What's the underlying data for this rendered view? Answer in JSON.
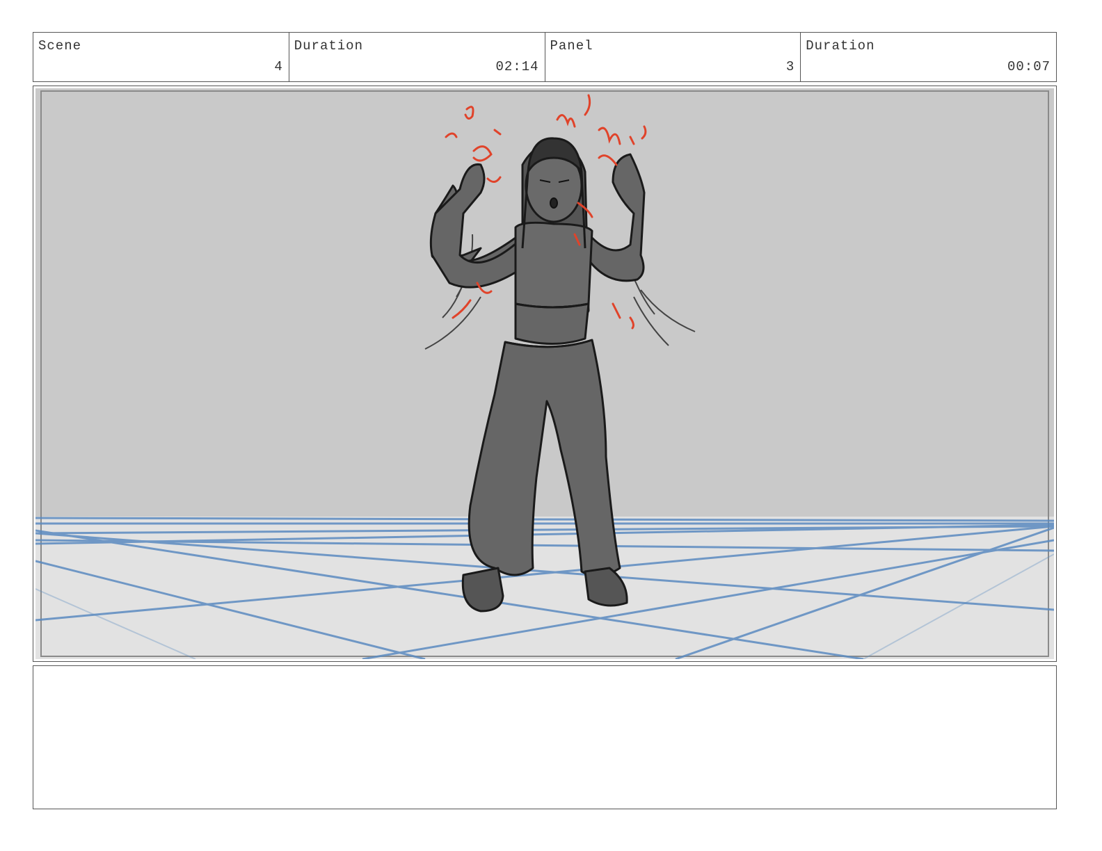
{
  "header": {
    "scene_label": "Scene",
    "scene_value": "4",
    "scene_duration_label": "Duration",
    "scene_duration_value": "02:14",
    "panel_label": "Panel",
    "panel_value": "3",
    "panel_duration_label": "Duration",
    "panel_duration_value": "00:07"
  },
  "notes": {
    "text": ""
  },
  "colors": {
    "wall": "#c9c9c9",
    "floor": "#e2e2e2",
    "grid": "#5b8bc0",
    "figure": "#666666",
    "outline": "#1a1a1a",
    "energy": "#e0432a"
  }
}
